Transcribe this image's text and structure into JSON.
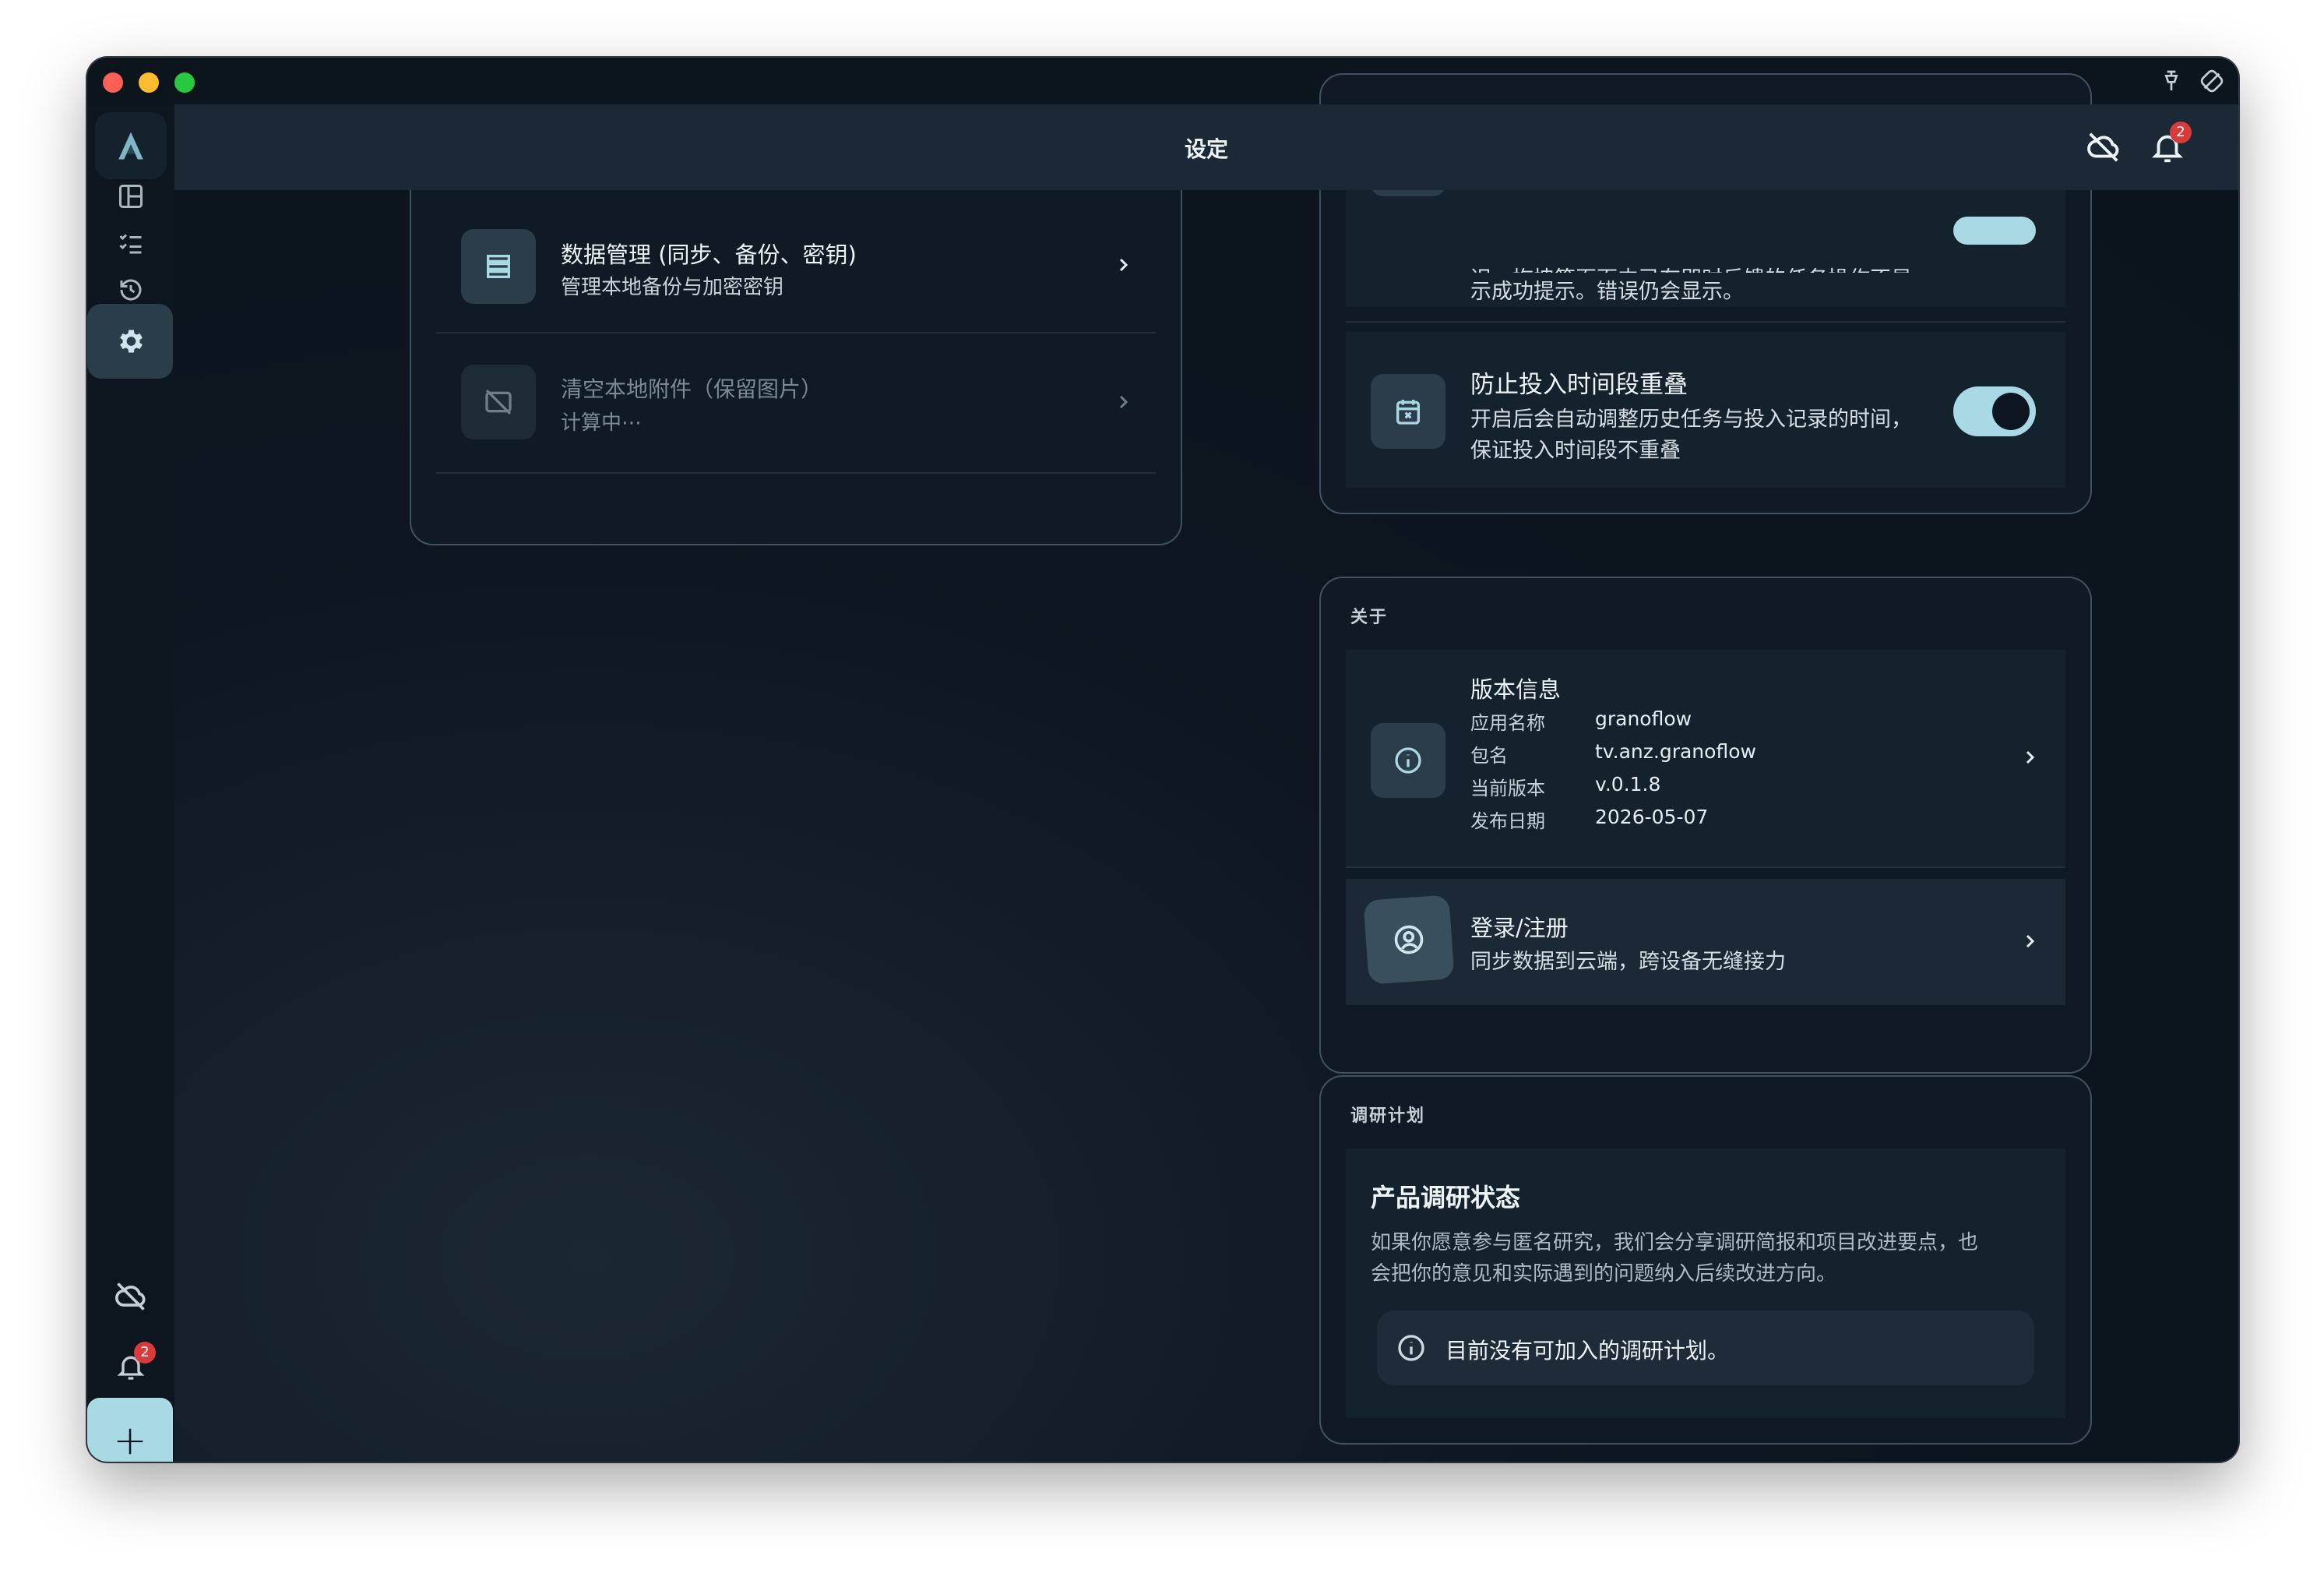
{
  "window": {
    "title": "设定"
  },
  "header": {
    "title": "设定",
    "notification_count": "2"
  },
  "sidebar": {
    "items": [
      {
        "name": "dashboard",
        "active": false
      },
      {
        "name": "tasks",
        "active": false
      },
      {
        "name": "history",
        "active": false
      },
      {
        "name": "settings",
        "active": true
      }
    ],
    "notification_count": "2",
    "add_label": "+"
  },
  "data_card": {
    "rows": [
      {
        "title": "数据管理 (同步、备份、密钥)",
        "subtitle": "管理本地备份与加密密钥"
      },
      {
        "title": "清空本地附件（保留图片）",
        "subtitle": "计算中⋯"
      }
    ]
  },
  "behavior_card": {
    "partial_row": {
      "line1": "迟、拖拽等页面内已有即时反馈的任务操作不显",
      "line2": "示成功提示。错误仍会显示。"
    },
    "overlap_row": {
      "title": "防止投入时间段重叠",
      "line1": "开启后会自动调整历史任务与投入记录的时间，",
      "line2": "保证投入时间段不重叠",
      "enabled": true
    }
  },
  "about": {
    "label": "关于",
    "version": {
      "title": "版本信息",
      "fields": [
        {
          "key": "应用名称",
          "value": "granoflow"
        },
        {
          "key": "包名",
          "value": "tv.anz.granoflow"
        },
        {
          "key": "当前版本",
          "value": "v.0.1.8"
        },
        {
          "key": "发布日期",
          "value": "2026-05-07"
        }
      ]
    },
    "login": {
      "title": "登录/注册",
      "subtitle": "同步数据到云端，跨设备无缝接力"
    }
  },
  "research": {
    "label": "调研计划",
    "title": "产品调研状态",
    "line1": "如果你愿意参与匿名研究，我们会分享调研简报和项目改进要点，也",
    "line2": "会把你的意见和实际遇到的问题纳入后续改进方向。",
    "notice": "目前没有可加入的调研计划。"
  },
  "colors": {
    "accent": "#a9d9e5",
    "badge": "#d93a3a",
    "background": "#0d1620"
  }
}
